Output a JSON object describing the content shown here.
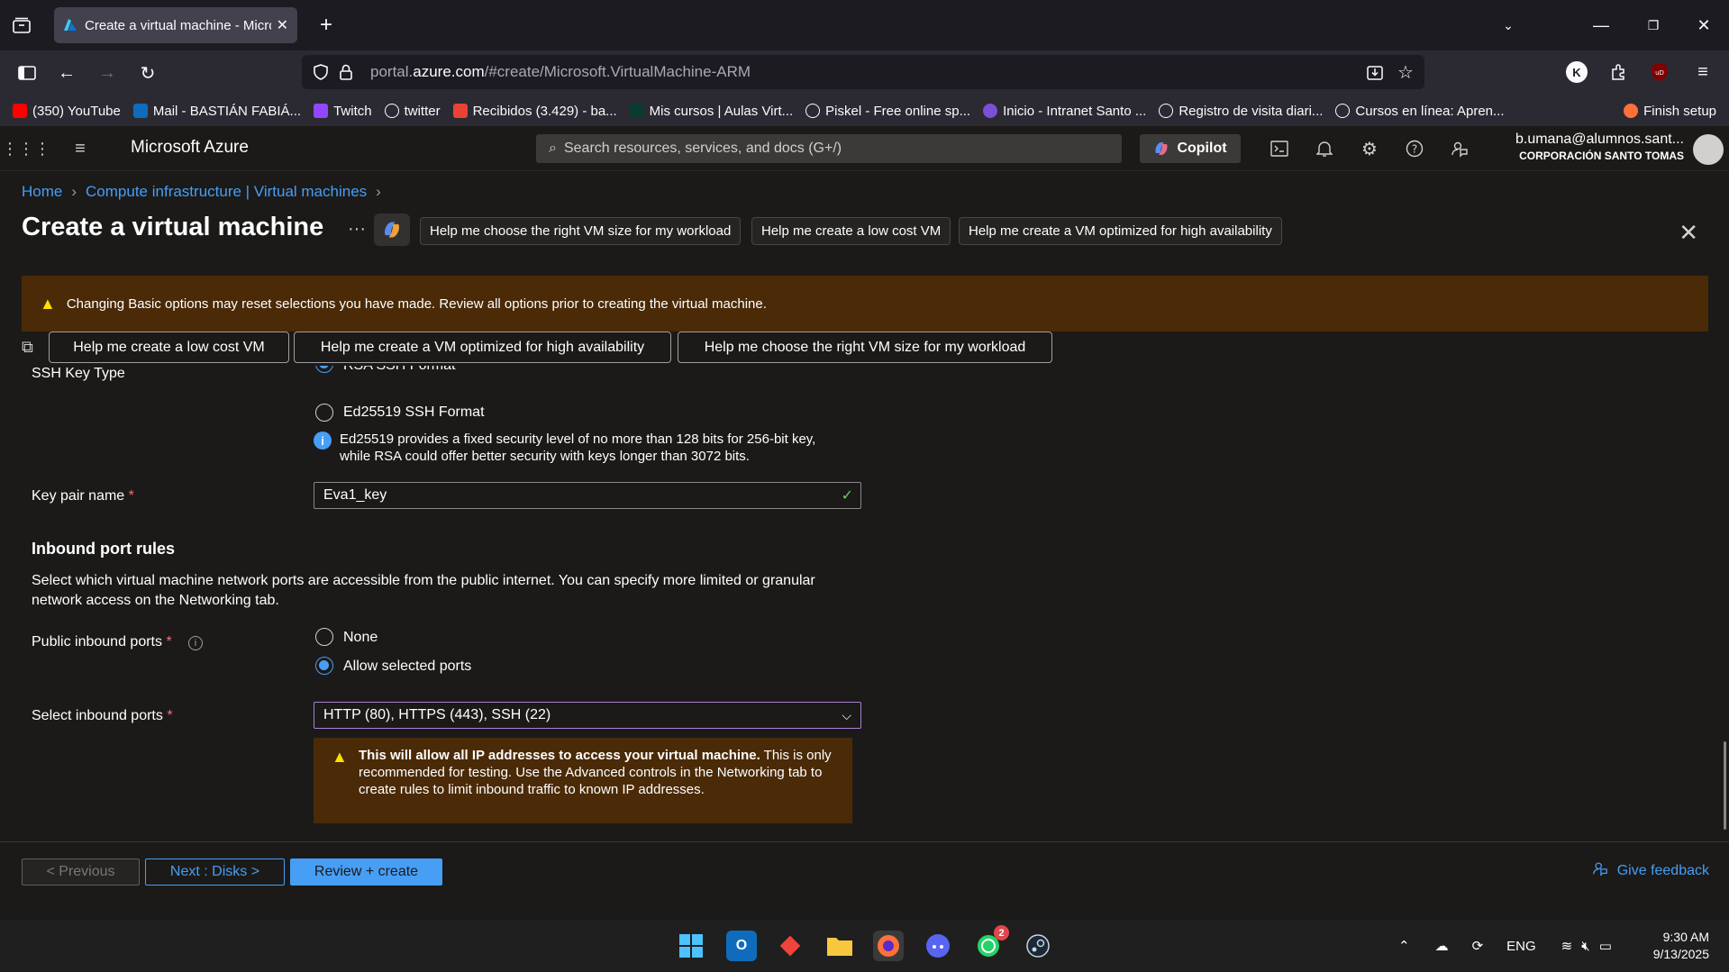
{
  "browser": {
    "tab_title": "Create a virtual machine - Micro",
    "url_prefix": "portal.",
    "url_domain": "azure.com",
    "url_path": "/#create/Microsoft.VirtualMachine-ARM",
    "bookmarks": [
      {
        "label": "(350) YouTube",
        "color": "#ff0000"
      },
      {
        "label": "Mail - BASTIÁN FABIÁ...",
        "color": "#0f6cbd"
      },
      {
        "label": "Twitch",
        "color": "#9146ff"
      },
      {
        "label": "twitter",
        "color": "#1c1b22"
      },
      {
        "label": "Recibidos (3.429) - ba...",
        "color": "#ea4335"
      },
      {
        "label": "Mis cursos | Aulas Virt...",
        "color": "#0b3b2e"
      },
      {
        "label": "Piskel - Free online sp...",
        "color": "#1c1b22"
      },
      {
        "label": "Inicio - Intranet Santo ...",
        "color": "#7b4fd6"
      },
      {
        "label": "Registro de visita diari...",
        "color": "#1c1b22"
      },
      {
        "label": "Cursos en línea: Apren...",
        "color": "#1c1b22"
      }
    ],
    "finish_setup": "Finish setup"
  },
  "azure": {
    "brand": "Microsoft Azure",
    "search_placeholder": "Search resources, services, and docs (G+/)",
    "copilot": "Copilot",
    "account_user": "b.umana@alumnos.sant...",
    "account_org": "CORPORACIÓN SANTO TOMAS"
  },
  "page": {
    "breadcrumb": [
      "Home",
      "Compute infrastructure | Virtual machines"
    ],
    "title": "Create a virtual machine",
    "ellipsis": "···",
    "chips": [
      "Help me choose the right VM size for my workload",
      "Help me create a low cost VM",
      "Help me create a VM optimized for high availability"
    ],
    "warning": "Changing Basic options may reset selections you have made. Review all options prior to creating the virtual machine.",
    "suggestions": [
      "Help me create a low cost VM",
      "Help me create a VM optimized for high availability",
      "Help me choose the right VM size for my workload"
    ]
  },
  "form": {
    "ssh_key_type_label": "SSH Key Type",
    "ssh_options": [
      "RSA SSH Format",
      "Ed25519 SSH Format"
    ],
    "ssh_info_line1": "Ed25519 provides a fixed security level of no more than 128 bits for 256-bit key,",
    "ssh_info_line2": "while RSA could offer better security with keys longer than 3072 bits.",
    "key_pair_label": "Key pair name",
    "key_pair_value": "Eva1_key",
    "inbound_heading": "Inbound port rules",
    "inbound_desc": "Select which virtual machine network ports are accessible from the public internet. You can specify more limited or granular network access on the Networking tab.",
    "public_ports_label": "Public inbound ports",
    "public_ports_options": [
      "None",
      "Allow selected ports"
    ],
    "select_ports_label": "Select inbound ports",
    "select_ports_value": "HTTP (80), HTTPS (443), SSH (22)",
    "ip_warning_bold": "This will allow all IP addresses to access your virtual machine.",
    "ip_warning_rest": "This is only recommended for testing.  Use the Advanced controls in the Networking tab to create rules to limit inbound traffic to known IP addresses.",
    "required_mark": "*"
  },
  "footer": {
    "previous": "< Previous",
    "next": "Next : Disks >",
    "review": "Review + create",
    "feedback": "Give feedback"
  },
  "taskbar": {
    "language": "ENG",
    "time": "9:30 AM",
    "date": "9/13/2025",
    "whatsapp_badge": "2"
  }
}
